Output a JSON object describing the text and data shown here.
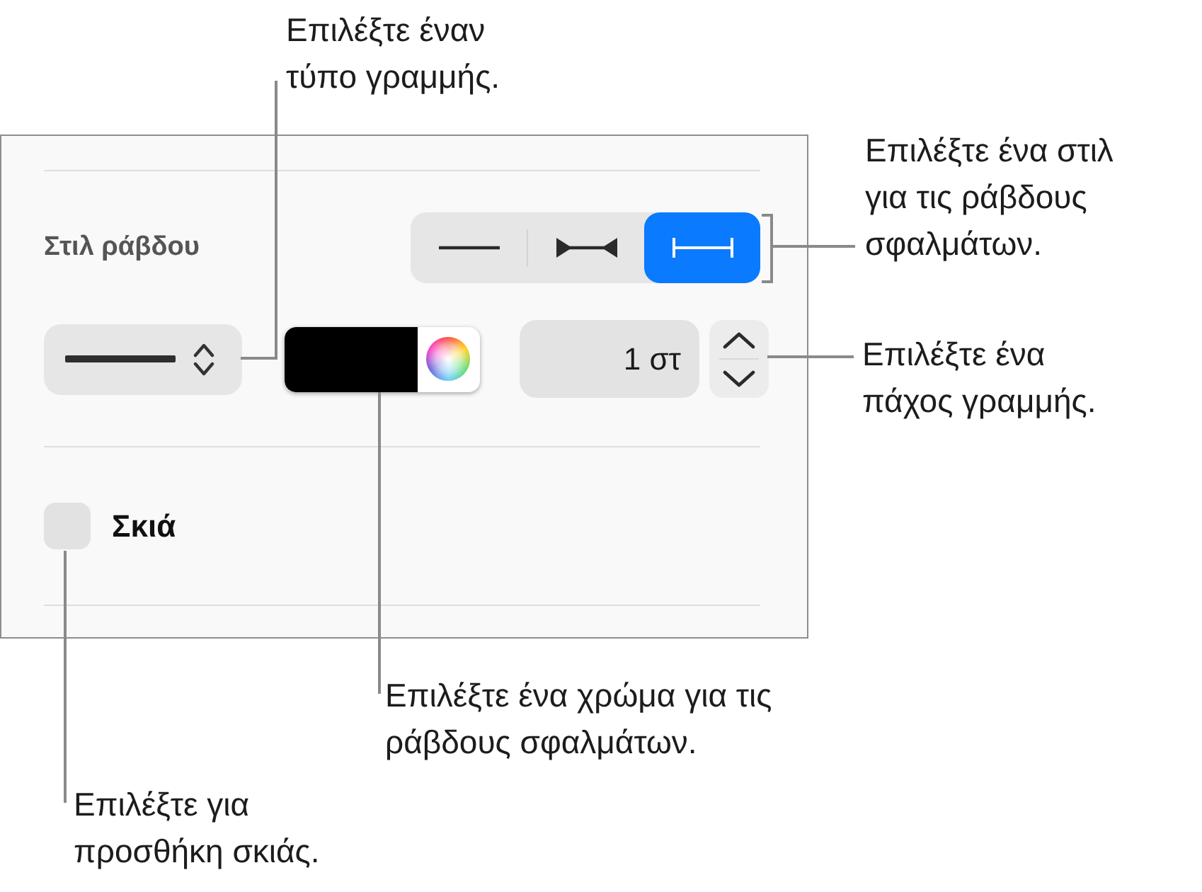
{
  "callouts": [
    {
      "text": "Επιλέξτε έναν\nτύπο γραμμής."
    },
    {
      "text": "Επιλέξτε ένα στιλ\nγια τις ράβδους\nσφαλμάτων."
    },
    {
      "text": "Επιλέξτε ένα\nπάχος γραμμής."
    },
    {
      "text": "Επιλέξτε ένα χρώμα για τις\nράβδους σφαλμάτων."
    },
    {
      "text": "Επιλέξτε για\nπροσθήκη σκιάς."
    }
  ],
  "panel": {
    "bar_style": {
      "label": "Στιλ ράβδου",
      "options": [
        {
          "kind": "line",
          "selected": false
        },
        {
          "kind": "arrows",
          "selected": false
        },
        {
          "kind": "caps",
          "selected": true
        }
      ]
    },
    "thickness": {
      "value": "1 στ"
    },
    "shadow": {
      "label": "Σκιά",
      "checked": false
    }
  }
}
